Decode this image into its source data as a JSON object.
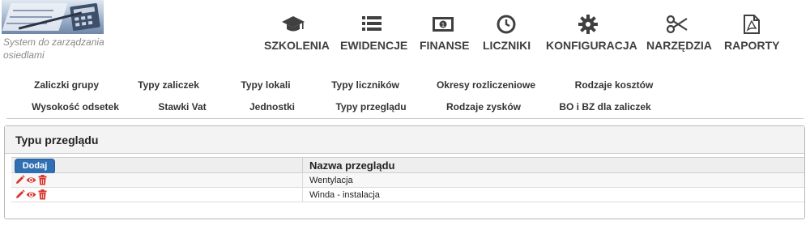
{
  "brand": {
    "tagline": "System do zarządzania osiedlami"
  },
  "nav": [
    {
      "label": "SZKOLENIA",
      "icon": "graduation-cap-icon"
    },
    {
      "label": "EWIDENCJE",
      "icon": "list-icon"
    },
    {
      "label": "FINANSE",
      "icon": "money-icon"
    },
    {
      "label": "LICZNIKI",
      "icon": "clock-icon"
    },
    {
      "label": "KONFIGURACJA",
      "icon": "gear-icon"
    },
    {
      "label": "NARZĘDZIA",
      "icon": "scissors-icon"
    },
    {
      "label": "RAPORTY",
      "icon": "pdf-file-icon"
    }
  ],
  "tabs_row1": [
    "Zaliczki grupy",
    "Typy zaliczek",
    "Typy lokali",
    "Typy liczników",
    "Okresy rozliczeniowe",
    "Rodzaje kosztów"
  ],
  "tabs_row2": [
    "Wysokość odsetek",
    "Stawki Vat",
    "Jednostki",
    "Typy przeglądu",
    "Rodzaje zysków",
    "BO i BZ dla zaliczek"
  ],
  "active_tab": "Typy przeglądu",
  "panel": {
    "title": "Typu przeglądu",
    "add_label": "Dodaj",
    "column_header": "Nazwa przeglądu",
    "rows": [
      "Wentylacja",
      "Winda - instalacja"
    ]
  },
  "colors": {
    "accent": "#2f6fb2",
    "action_red": "#d9342b",
    "active_tab": "#c9c9c9"
  }
}
